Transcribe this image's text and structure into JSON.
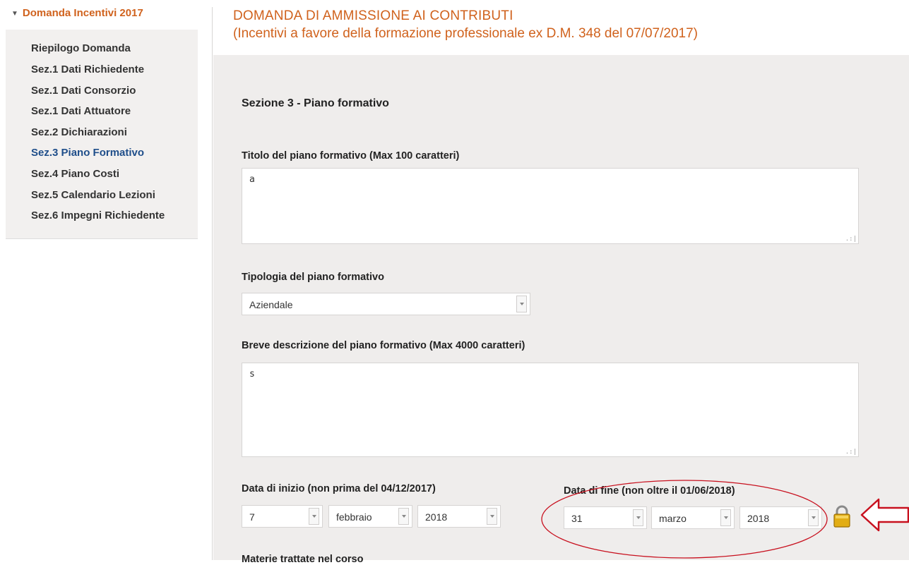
{
  "sidebar": {
    "title": "Domanda Incentivi 2017",
    "items": [
      {
        "label": "Riepilogo Domanda",
        "active": false
      },
      {
        "label": "Sez.1 Dati Richiedente",
        "active": false
      },
      {
        "label": "Sez.1 Dati Consorzio",
        "active": false
      },
      {
        "label": "Sez.1 Dati Attuatore",
        "active": false
      },
      {
        "label": "Sez.2 Dichiarazioni",
        "active": false
      },
      {
        "label": "Sez.3 Piano Formativo",
        "active": true
      },
      {
        "label": "Sez.4 Piano Costi",
        "active": false
      },
      {
        "label": "Sez.5 Calendario Lezioni",
        "active": false
      },
      {
        "label": "Sez.6 Impegni Richiedente",
        "active": false
      }
    ]
  },
  "header": {
    "title": "DOMANDA DI AMMISSIONE AI CONTRIBUTI",
    "subtitle": "(Incentivi a favore della formazione professionale ex D.M. 348 del 07/07/2017)"
  },
  "form": {
    "section_title": "Sezione 3 - Piano formativo",
    "titolo": {
      "label": "Titolo del piano formativo (Max 100 caratteri)",
      "value": "a"
    },
    "tipologia": {
      "label": "Tipologia del piano formativo",
      "value": "Aziendale"
    },
    "descrizione": {
      "label": "Breve descrizione del piano formativo (Max 4000 caratteri)",
      "value": "s"
    },
    "data_inizio": {
      "label": "Data di inizio (non prima del 04/12/2017)",
      "day": "7",
      "month": "febbraio",
      "year": "2018"
    },
    "data_fine": {
      "label": "Data di fine (non oltre il 01/06/2018)",
      "day": "31",
      "month": "marzo",
      "year": "2018"
    },
    "materie": {
      "label": "Materie trattate nel corso"
    }
  },
  "colors": {
    "accent": "#d0621d",
    "active_link": "#1f4e8a",
    "annotation": "#c8101e"
  },
  "icons": {
    "lock": "lock-icon",
    "arrow": "left-arrow-annotation-icon",
    "select_arrow": "chevron-down-icon"
  }
}
